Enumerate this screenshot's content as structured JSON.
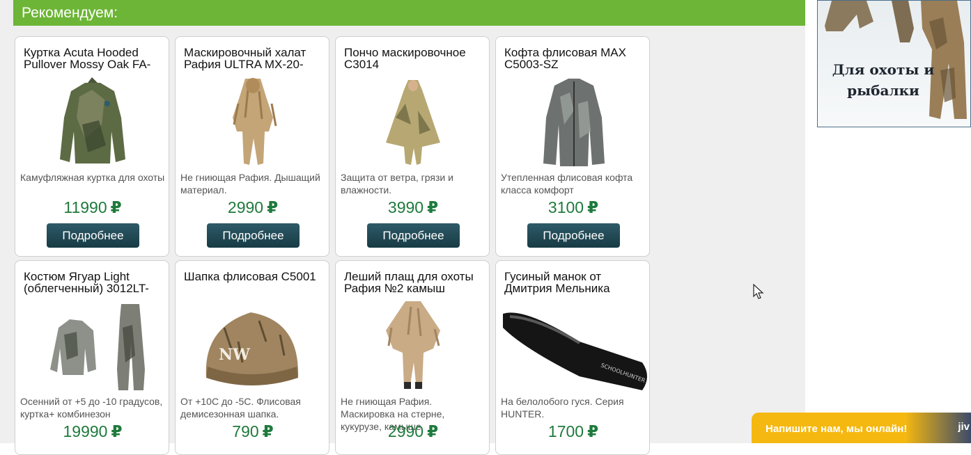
{
  "section": {
    "title": "Рекомендуем:"
  },
  "products": [
    {
      "title": "Куртка Acuta Hooded Pullover Mossy Oak FA-",
      "description": "Камуфляжная куртка для охоты",
      "price": "11990",
      "currency": "₽",
      "button": "Подробнее",
      "image_icon": "camo-jacket-image"
    },
    {
      "title": "Маскировочный халат Рафия ULTRA MX-20-",
      "description": "Не гниющая Рафия. Дышащий материал.",
      "price": "2990",
      "currency": "₽",
      "button": "Подробнее",
      "image_icon": "ghillie-suit-image"
    },
    {
      "title": "Пончо маскировочное С3014",
      "description": "Защита от ветра, грязи и влажности.",
      "price": "3990",
      "currency": "₽",
      "button": "Подробнее",
      "image_icon": "poncho-image"
    },
    {
      "title": "Кофта флисовая MAX С5003-SZ",
      "description": "Утепленная флисовая кофта класса комфорт",
      "price": "3100",
      "currency": "₽",
      "button": "Подробнее",
      "image_icon": "fleece-jacket-image"
    },
    {
      "title": "Костюм Ягуар Light (облегченный) 3012LT-",
      "description": "Осенний от +5 до -10 градусов, куртка+ комбинезон",
      "price": "19990",
      "currency": "₽",
      "button": "Подробнее",
      "image_icon": "camo-suit-image"
    },
    {
      "title": "Шапка флисовая С5001",
      "description": "От +10С до -5С. Флисовая демисезонная шапка.",
      "price": "790",
      "currency": "₽",
      "button": "Подробнее",
      "image_icon": "fleece-hat-image",
      "hat_logo": "NW"
    },
    {
      "title": "Леший плащ для охоты Рафия №2 камыш",
      "description": "Не гниющая Рафия. Маскировка на стерне, кукурузе, камыше",
      "price": "2990",
      "currency": "₽",
      "button": "Подробнее",
      "image_icon": "ghillie-cloak-image"
    },
    {
      "title": "Гусиный манок от Дмитрия Мельника",
      "description": "На белолобого гуся. Серия HUNTER.",
      "price": "1700",
      "currency": "₽",
      "button": "Подробнее",
      "image_icon": "goose-call-image",
      "call_logo": "SCHOOLHUNTER"
    }
  ],
  "banner": {
    "text": "Для охоты и рыбалки"
  },
  "chat": {
    "text": "Напишите нам, мы онлайн!",
    "logo": "jiv"
  },
  "colors": {
    "header": "#6db536",
    "price": "#1e7a3c",
    "button": "#1f4550",
    "chat": "#f5b810"
  }
}
